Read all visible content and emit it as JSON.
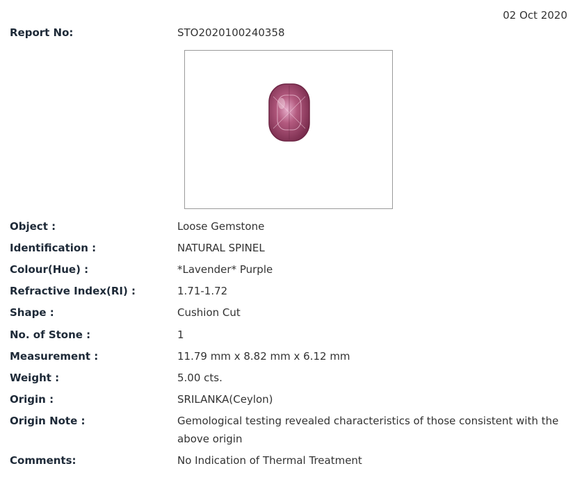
{
  "report": {
    "date": "02 Oct 2020",
    "report_no_label": "Report No:",
    "report_no_value": "STO2020100240358"
  },
  "gem_image": {
    "description_icon": "gemstone-photo",
    "color_main": "#b35a7f",
    "color_dark": "#7a2d4e",
    "color_light": "#e7aecb"
  },
  "fields": [
    {
      "label": "Object :",
      "value": "Loose Gemstone"
    },
    {
      "label": "Identification :",
      "value": "NATURAL SPINEL"
    },
    {
      "label": "Colour(Hue) :",
      "value": "*Lavender* Purple"
    },
    {
      "label": "Refractive Index(RI) :",
      "value": "1.71-1.72"
    },
    {
      "label": "Shape :",
      "value": "Cushion Cut"
    },
    {
      "label": "No. of Stone :",
      "value": "1"
    },
    {
      "label": "Measurement :",
      "value": "11.79 mm x 8.82 mm x 6.12 mm"
    },
    {
      "label": "Weight :",
      "value": "5.00 cts."
    },
    {
      "label": "Origin :",
      "value": "SRILANKA(Ceylon)"
    },
    {
      "label": "Origin Note :",
      "value": "Gemological testing revealed characteristics of those consistent with the above origin"
    },
    {
      "label": "Comments:",
      "value": "No Indication of Thermal Treatment"
    }
  ]
}
